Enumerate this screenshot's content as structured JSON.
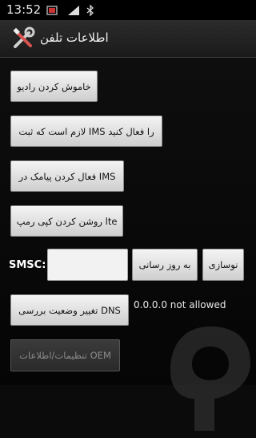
{
  "statusbar": {
    "time": "13:52"
  },
  "app": {
    "title": "اطلاعات تلفن"
  },
  "buttons": {
    "radio_off": "خاموش کردن رادیو",
    "ims_reg": "لازم است که ثبت IMS را فعال کنید",
    "ims_sms": "فعال کردن پیامک در IMS",
    "lte_ram": "روشن کردن کپی رمپ lte",
    "update": "به روز رسانی",
    "refresh": "نوسازی",
    "dns_toggle": "تغییر وضعیت بررسی DNS",
    "oem_settings": "تنظیمات/اطلاعات OEM"
  },
  "smsc": {
    "label": "SMSC:",
    "value": ""
  },
  "dns_status": "0.0.0.0 not allowed",
  "icons": [
    "signal-icon",
    "wifi-icon",
    "bluetooth-icon",
    "notification-icon",
    "tools-icon",
    "watermark-logo-icon"
  ]
}
